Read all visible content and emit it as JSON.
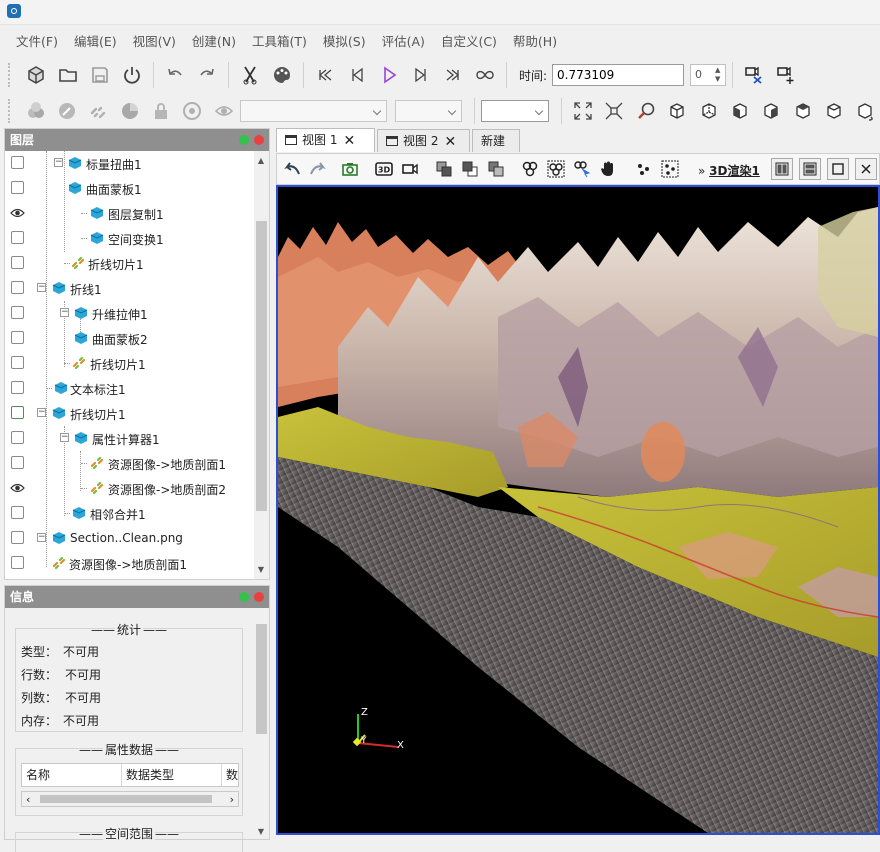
{
  "menu": [
    "文件(F)",
    "编辑(E)",
    "视图(V)",
    "创建(N)",
    "工具箱(T)",
    "模拟(S)",
    "评估(A)",
    "自定义(C)",
    "帮助(H)"
  ],
  "time": {
    "label": "时间:",
    "value": "0.773109",
    "spin_value": "0"
  },
  "layers_panel": {
    "title": "图层",
    "items": [
      {
        "label": "标量扭曲1"
      },
      {
        "label": "曲面蒙板1"
      },
      {
        "label": "图层复制1"
      },
      {
        "label": "空间变换1"
      },
      {
        "label": "折线切片1"
      },
      {
        "label": "折线1"
      },
      {
        "label": "升维拉伸1"
      },
      {
        "label": "曲面蒙板2"
      },
      {
        "label": "折线切片1"
      },
      {
        "label": "文本标注1"
      },
      {
        "label": "折线切片1"
      },
      {
        "label": "属性计算器1"
      },
      {
        "label": "资源图像->地质剖面1"
      },
      {
        "label": "资源图像->地质剖面2"
      },
      {
        "label": "相邻合并1"
      },
      {
        "label": "Section..Clean.png"
      },
      {
        "label": "资源图像->地质剖面1"
      }
    ]
  },
  "info_panel": {
    "title": "信息",
    "stats_title": "统计",
    "stats": [
      {
        "key": "类型：",
        "value": "不可用"
      },
      {
        "key": "行数：",
        "value": "不可用"
      },
      {
        "key": "列数：",
        "value": "不可用"
      },
      {
        "key": "内存：",
        "value": "不可用"
      }
    ],
    "attr_title": "属性数据",
    "attr_columns": [
      "名称",
      "数据类型",
      "数"
    ],
    "range_title": "空间范围"
  },
  "tabs": [
    {
      "label": "视图 1"
    },
    {
      "label": "视图 2"
    },
    {
      "label": "新建"
    }
  ],
  "view_toolbar": {
    "render_label": "3D渲染1",
    "prefix": "»"
  },
  "axes": {
    "z": "Z",
    "y": "Y",
    "x": "X"
  },
  "colors": {
    "accent_border": "#2d4fd6",
    "panel_header": "#8f8f8f"
  }
}
